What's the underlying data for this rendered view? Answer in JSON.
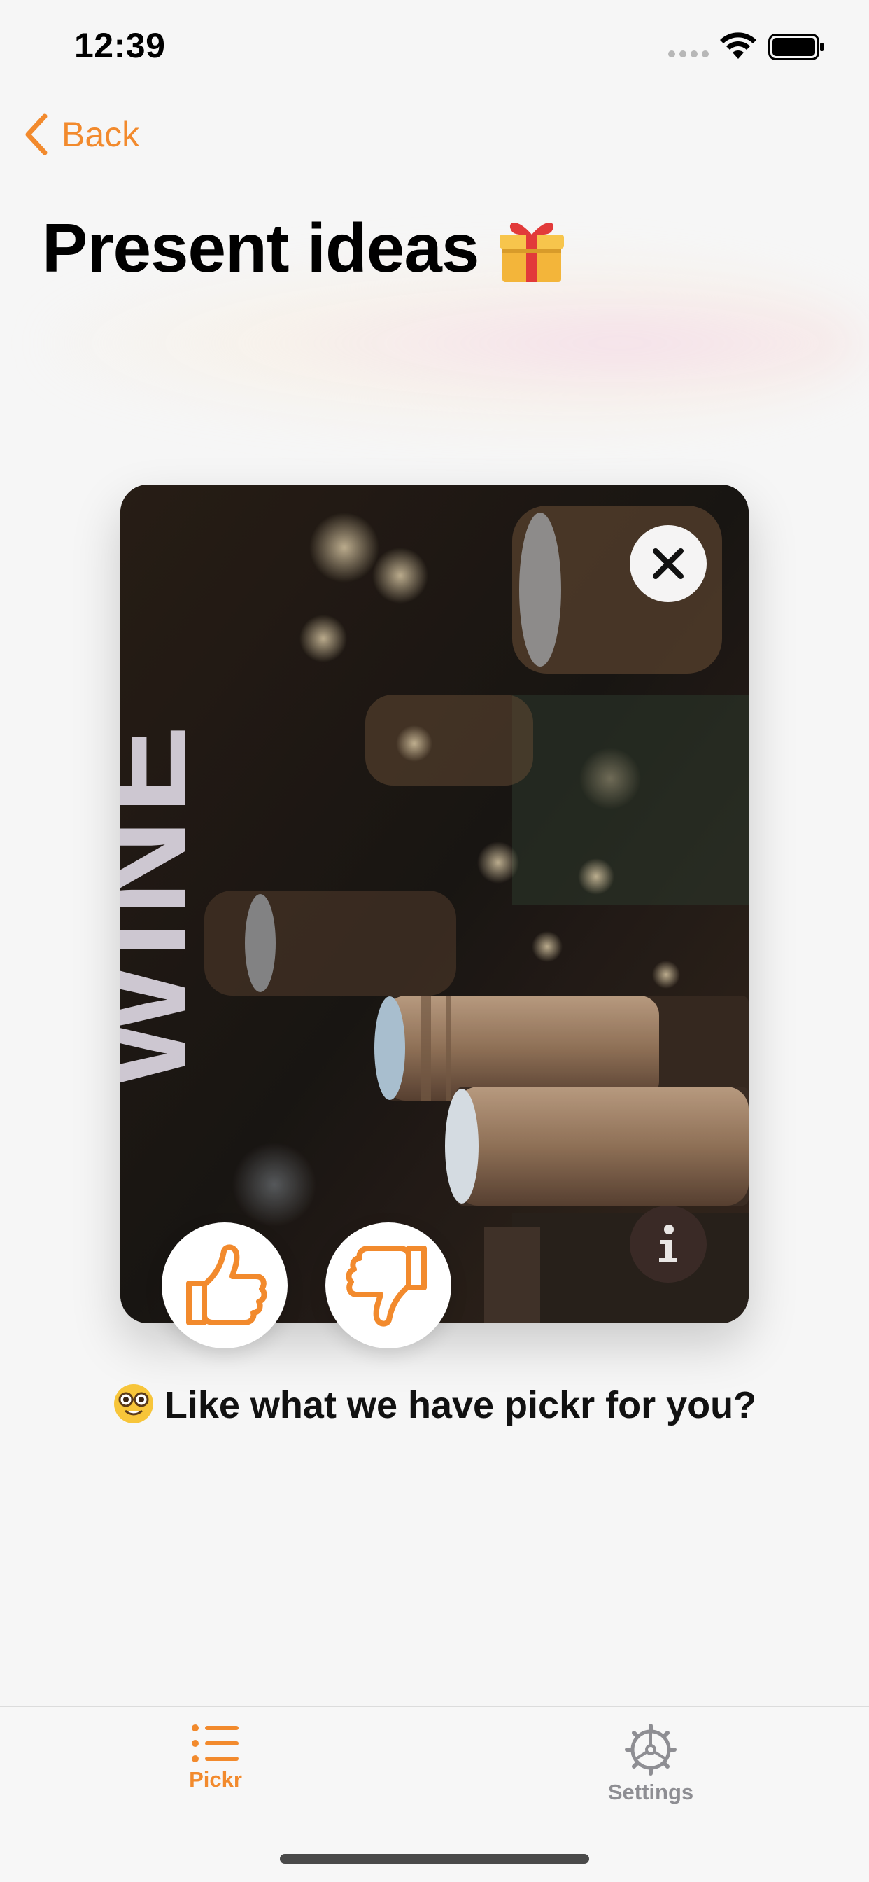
{
  "status_bar": {
    "time": "12:39"
  },
  "nav": {
    "back_label": "Back"
  },
  "header": {
    "title": "Present ideas",
    "title_icon": "gift-icon"
  },
  "card": {
    "title": "WINE",
    "photo": "wine bottles in rack",
    "close_icon": "close-icon",
    "info_icon": "info-icon"
  },
  "actions": {
    "like_icon": "thumbs-up-icon",
    "dislike_icon": "thumbs-down-icon"
  },
  "prompt": {
    "emoji": "nerd-face-emoji",
    "text": "Like what we have pickr for you?"
  },
  "tab_bar": {
    "tabs": [
      {
        "label": "Pickr",
        "icon": "list-icon",
        "active": true
      },
      {
        "label": "Settings",
        "icon": "gear-icon",
        "active": false
      }
    ]
  },
  "colors": {
    "accent": "#f28a2d",
    "inactive": "#8e8e93",
    "background": "#f6f6f6"
  }
}
